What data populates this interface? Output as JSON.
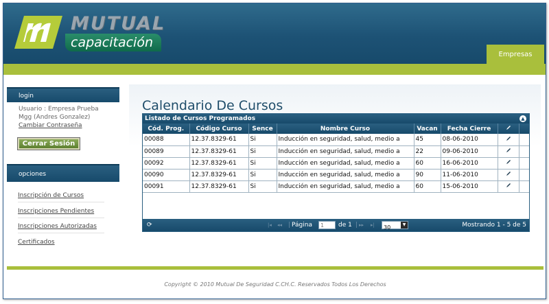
{
  "header": {
    "brand_top": "MUTUAL",
    "brand_bottom": "capacitación",
    "tab_label": "Empresas",
    "colors": {
      "header_blue": "#1d5275",
      "accent_green": "#a9bf3c",
      "brand_green": "#0f6a4a"
    }
  },
  "sidebar": {
    "login_title": "login",
    "user_line": "Usuario : Empresa Prueba",
    "user_name": "Mgg (Andres Gonzalez)",
    "change_password": "Cambiar Contraseña",
    "logout_button": "Cerrar Sesión",
    "options_title": "opciones",
    "nav": [
      {
        "label": "Inscripción de Cursos"
      },
      {
        "label": "Inscripciones Pendientes"
      },
      {
        "label": "Inscripciones Autorizadas"
      },
      {
        "label": "Certificados"
      }
    ]
  },
  "main": {
    "title": "Calendario De Cursos",
    "grid": {
      "caption": "Listado de Cursos Programados",
      "columns": [
        "Cód. Prog.",
        "Código Curso",
        "Sence",
        "Nombre Curso",
        "Vacan",
        "Fecha Cierre"
      ],
      "rows": [
        [
          "00088",
          "12.37.8329-61",
          "Si",
          "Inducción en seguridad, salud, medio a",
          "45",
          "08-06-2010"
        ],
        [
          "00089",
          "12.37.8329-61",
          "Si",
          "Inducción en seguridad, salud, medio a",
          "22",
          "09-06-2010"
        ],
        [
          "00092",
          "12.37.8329-61",
          "Si",
          "Inducción en seguridad, salud, medio a",
          "60",
          "16-06-2010"
        ],
        [
          "00090",
          "12.37.8329-61",
          "Si",
          "Inducción en seguridad, salud, medio a",
          "90",
          "11-06-2010"
        ],
        [
          "00091",
          "12.37.8329-61",
          "Si",
          "Inducción en seguridad, salud, medio a",
          "60",
          "15-06-2010"
        ]
      ],
      "pager": {
        "page_label": "Página",
        "page_value": "1",
        "of_label": "de 1",
        "page_size": "30",
        "showing": "Mostrando 1 - 5 de 5"
      }
    }
  },
  "footer": {
    "copyright": "Copyright © 2010 Mutual De Seguridad C.CH.C. Reservados Todos Los Derechos"
  }
}
